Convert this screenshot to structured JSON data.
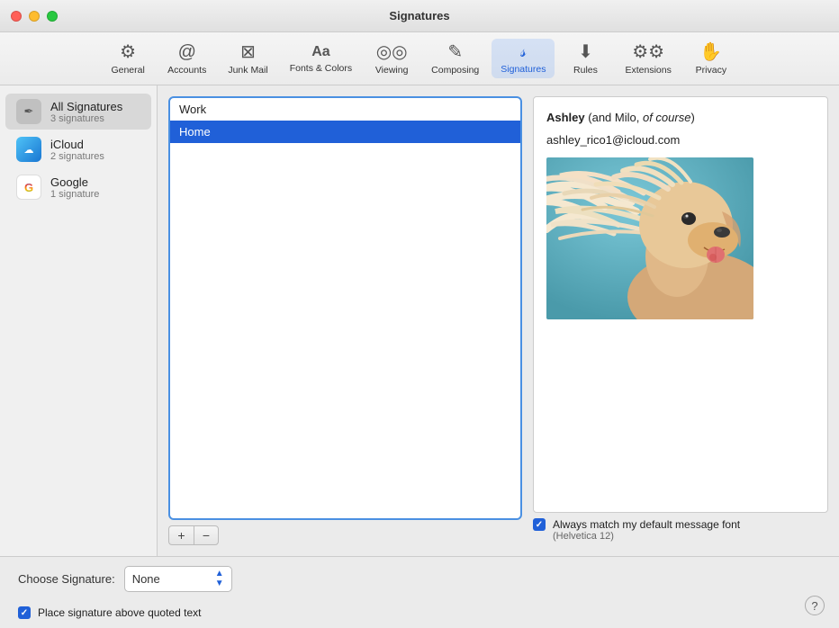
{
  "window": {
    "title": "Signatures"
  },
  "toolbar": {
    "items": [
      {
        "id": "general",
        "label": "General",
        "icon": "⚙️"
      },
      {
        "id": "accounts",
        "label": "Accounts",
        "icon": "✉️"
      },
      {
        "id": "junk-mail",
        "label": "Junk Mail",
        "icon": "🗑️"
      },
      {
        "id": "fonts-colors",
        "label": "Fonts & Colors",
        "icon": "Aa"
      },
      {
        "id": "viewing",
        "label": "Viewing",
        "icon": "👁️"
      },
      {
        "id": "composing",
        "label": "Composing",
        "icon": "✏️"
      },
      {
        "id": "signatures",
        "label": "Signatures",
        "icon": "✒️",
        "active": true
      },
      {
        "id": "rules",
        "label": "Rules",
        "icon": "📋"
      },
      {
        "id": "extensions",
        "label": "Extensions",
        "icon": "🧩"
      },
      {
        "id": "privacy",
        "label": "Privacy",
        "icon": "✋"
      }
    ]
  },
  "sidebar": {
    "items": [
      {
        "id": "all-signatures",
        "label": "All Signatures",
        "count": "3 signatures",
        "iconType": "all"
      },
      {
        "id": "icloud",
        "label": "iCloud",
        "count": "2 signatures",
        "iconType": "icloud"
      },
      {
        "id": "google",
        "label": "Google",
        "count": "1 signature",
        "iconType": "google"
      }
    ]
  },
  "signatures_list": {
    "items": [
      {
        "id": "work",
        "label": "Work",
        "selected": false
      },
      {
        "id": "home",
        "label": "Home",
        "selected": true
      }
    ],
    "add_button": "+",
    "remove_button": "−"
  },
  "preview": {
    "name_bold": "Ashley",
    "name_rest": " (and Milo, ",
    "name_italic": "of course",
    "name_close": ")",
    "email": "ashley_rico1@icloud.com",
    "font_match_label": "Always match my default message font",
    "font_match_sub": "(Helvetica 12)",
    "font_match_checked": true
  },
  "bottom_bar": {
    "choose_signature_label": "Choose Signature:",
    "choose_signature_value": "None",
    "place_above_label": "Place signature above quoted text",
    "place_above_checked": true,
    "help_label": "?"
  },
  "colors": {
    "accent_blue": "#2060d8",
    "selected_blue": "#1e5fd6"
  }
}
